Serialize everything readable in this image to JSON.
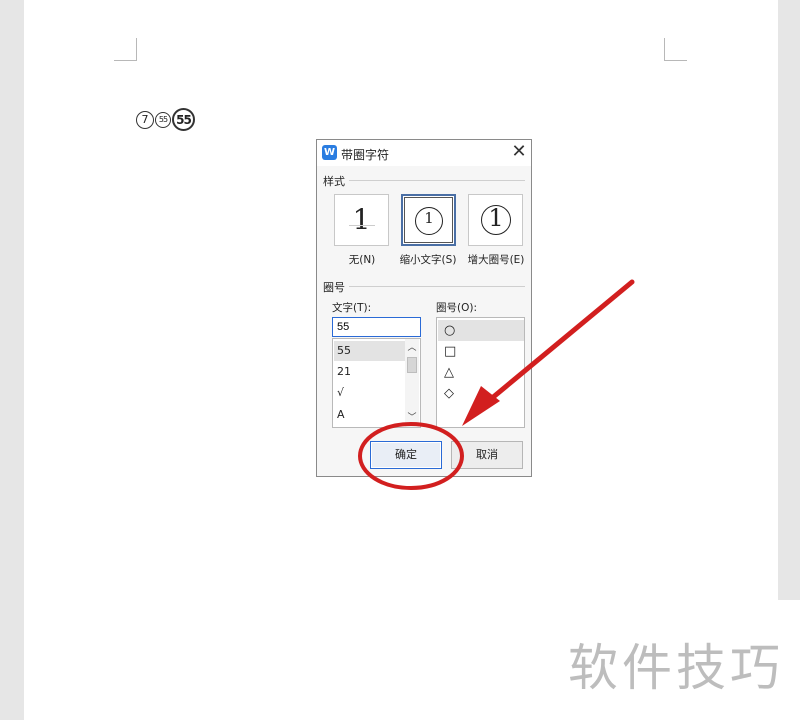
{
  "document": {
    "circled_chars": [
      {
        "text": "7",
        "style": "plain-circle"
      },
      {
        "text": "55",
        "style": "small-text"
      },
      {
        "text": "55",
        "style": "bold-large"
      }
    ]
  },
  "dialog": {
    "title": "带圈字符",
    "close_glyph": "✕",
    "app_icon": "W",
    "style_section": {
      "label": "样式",
      "options": [
        {
          "caption": "无(N)",
          "sample": "1",
          "selected": false
        },
        {
          "caption": "缩小文字(S)",
          "sample": "1",
          "selected": true
        },
        {
          "caption": "增大圈号(E)",
          "sample": "1",
          "selected": false
        }
      ]
    },
    "enclosure_section": {
      "label": "圈号",
      "text_label": "文字(T):",
      "text_value": "55",
      "text_list": [
        "55",
        "21",
        "√",
        "A"
      ],
      "selected_text_index": 0,
      "enclosure_label": "圈号(O):",
      "enclosure_list": [
        "○",
        "□",
        "△",
        "◇"
      ],
      "selected_enclosure_index": 0
    },
    "ok_label": "确定",
    "cancel_label": "取消"
  },
  "annotation": {
    "color": "#d21f1f",
    "arrow_target": "ok-button"
  },
  "watermark": "软件技巧",
  "colors": {
    "accent": "#2a6ad6",
    "app_icon": "#2a7de1",
    "annotation": "#d21f1f"
  }
}
